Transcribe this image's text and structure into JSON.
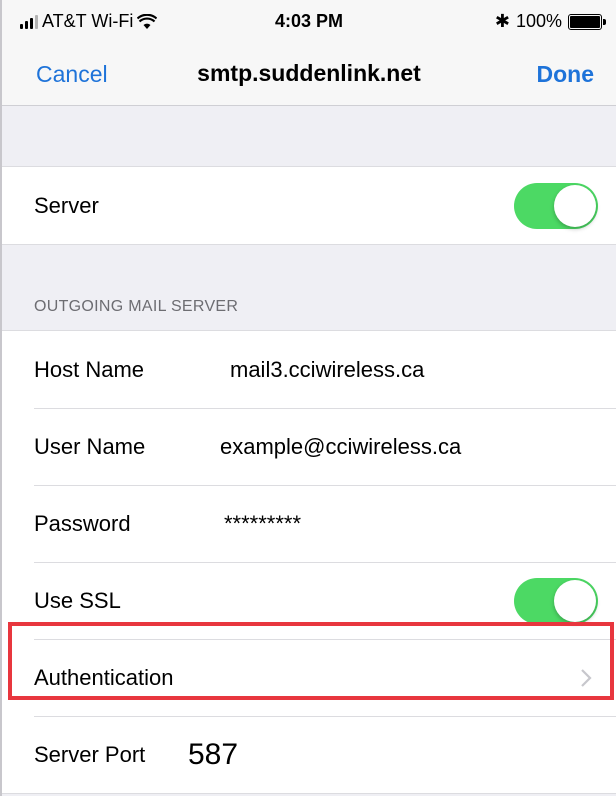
{
  "status_bar": {
    "carrier": "AT&T Wi-Fi",
    "time": "4:03 PM",
    "bluetooth_symbol": "✱",
    "battery": "100%"
  },
  "nav": {
    "cancel_label": "Cancel",
    "title": "smtp.suddenlink.net",
    "done_label": "Done"
  },
  "server_group": {
    "server_label": "Server",
    "server_enabled": true
  },
  "outgoing": {
    "section_header": "OUTGOING MAIL SERVER",
    "host_name_label": "Host Name",
    "host_name_value": "mail3.cciwireless.ca",
    "user_name_label": "User Name",
    "user_name_value": "example@cciwireless.ca",
    "password_label": "Password",
    "password_value": "*********",
    "use_ssl_label": "Use SSL",
    "use_ssl_enabled": true,
    "authentication_label": "Authentication",
    "server_port_label": "Server Port",
    "server_port_value": "587"
  },
  "colors": {
    "accent": "#1e73d9",
    "toggle_on": "#4cd964",
    "highlight": "#e8363e"
  }
}
